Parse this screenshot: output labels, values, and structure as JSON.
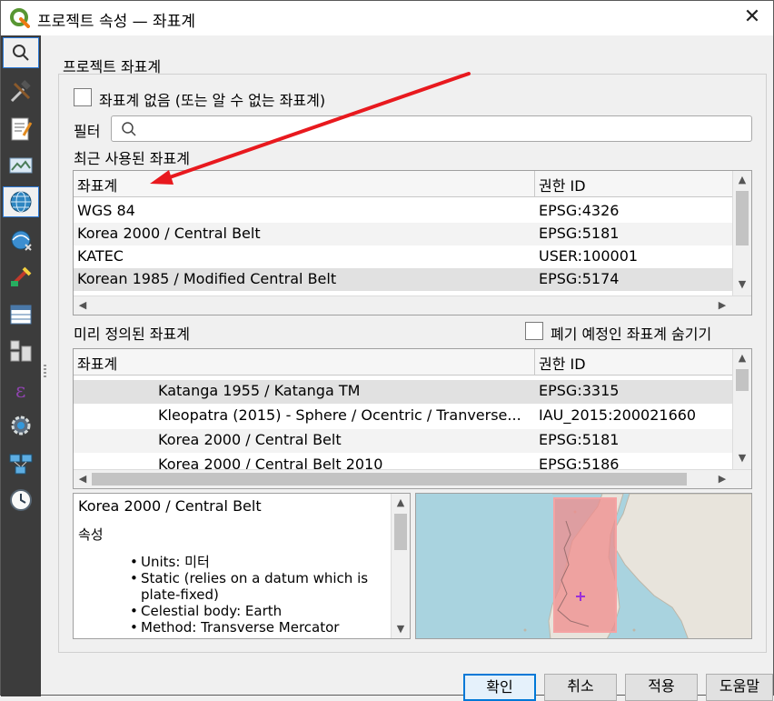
{
  "window": {
    "title": "프로젝트 속성 — 좌표계",
    "close_glyph": "✕"
  },
  "sidebar": {
    "items": [
      {
        "icon": "search-icon",
        "active": true
      },
      {
        "icon": "tools-icon"
      },
      {
        "icon": "metadata-icon"
      },
      {
        "icon": "view-settings-icon"
      },
      {
        "icon": "crs-globe-icon",
        "active": true
      },
      {
        "icon": "transformations-icon"
      },
      {
        "icon": "styles-icon"
      },
      {
        "icon": "data-sources-icon"
      },
      {
        "icon": "relations-icon"
      },
      {
        "icon": "variables-icon"
      },
      {
        "icon": "macros-icon"
      },
      {
        "icon": "qgis-server-icon"
      },
      {
        "icon": "temporal-icon"
      }
    ]
  },
  "crs_section": {
    "title": "프로젝트 좌표계",
    "no_crs_label": "좌표계 없음 (또는 알 수 없는 좌표계)",
    "filter_label": "필터",
    "filter_placeholder": "",
    "recent": {
      "title": "최근 사용된 좌표계",
      "columns": [
        "좌표계",
        "권한 ID"
      ],
      "rows": [
        [
          "WGS 84",
          "EPSG:4326"
        ],
        [
          "Korea 2000 / Central Belt",
          "EPSG:5181"
        ],
        [
          "KATEC",
          "USER:100001"
        ],
        [
          "Korean 1985 / Modified Central Belt",
          "EPSG:5174"
        ]
      ]
    },
    "predefined": {
      "title": "미리 정의된 좌표계",
      "hide_deprecated_label": "폐기 예정인 좌표계 숨기기",
      "columns": [
        "좌표계",
        "권한 ID"
      ],
      "rows": [
        [
          "Katanga 1955 / Katanga TM",
          "EPSG:3315"
        ],
        [
          "Kleopatra (2015) - Sphere / Ocentric / Tranverse...",
          "IAU_2015:200021660"
        ],
        [
          "Korea 2000 / Central Belt",
          "EPSG:5181"
        ],
        [
          "Korea 2000 / Central Belt 2010",
          "EPSG:5186"
        ]
      ]
    },
    "info": {
      "name": "Korea 2000 / Central Belt",
      "properties_heading": "속성",
      "properties": [
        "Units: 미터",
        "Static (relies on a datum which is plate-fixed)",
        "Celestial body: Earth",
        "Method: Transverse Mercator"
      ]
    }
  },
  "buttons": {
    "ok": "확인",
    "cancel": "취소",
    "apply": "적용",
    "help": "도움말"
  },
  "colors": {
    "annotation_arrow": "#e8191e",
    "extent_fill": "#f08c8c",
    "accent": "#0078d7"
  }
}
